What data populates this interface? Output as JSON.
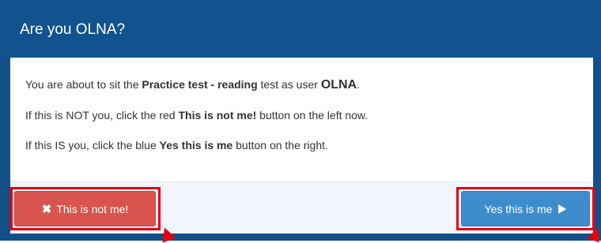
{
  "dialog": {
    "title": "Are you OLNA?",
    "lines": [
      {
        "pre": "You are about to sit the ",
        "bold": "Practice test - reading",
        "mid": " test as user ",
        "user": "OLNA",
        "post": "."
      },
      {
        "pre": "If this is NOT you, click the red ",
        "bold": "This is not me!",
        "post": " button on the left now."
      },
      {
        "pre": "If this IS you, click the blue ",
        "bold": "Yes this is me",
        "post": " button on the right."
      }
    ]
  },
  "buttons": {
    "not_me_label": "This is not me!",
    "not_me_icon": "x-icon",
    "yes_label": "Yes this is me",
    "yes_icon": "play-icon"
  },
  "colors": {
    "header_bg": "#12528e",
    "frame": "#13508a",
    "danger": "#d9534f",
    "primary": "#3f8ccc",
    "highlight": "#e8000b"
  }
}
